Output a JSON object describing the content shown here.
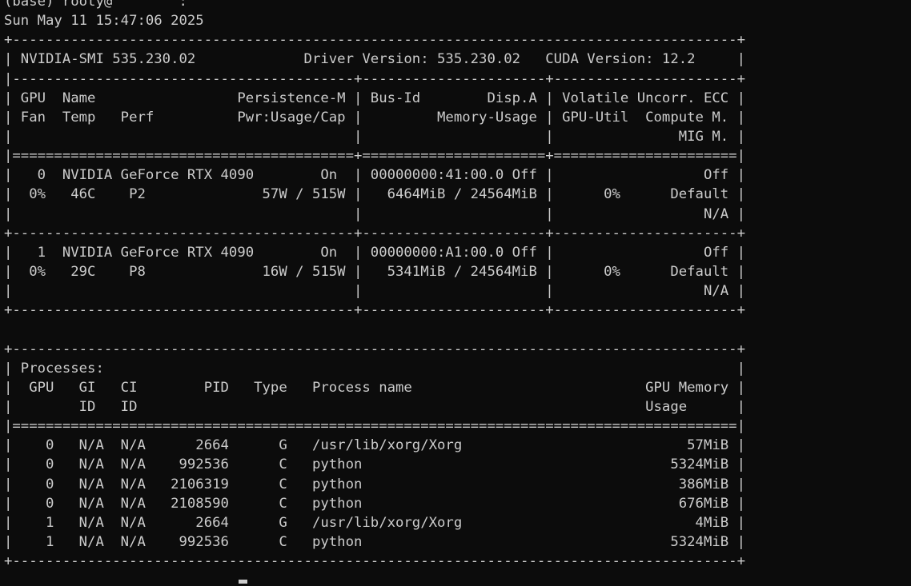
{
  "terminal": {
    "lines": [
      "(base) rooty@        :",
      "Sun May 11 15:47:06 2025",
      "+---------------------------------------------------------------------------------------+",
      "| NVIDIA-SMI 535.230.02             Driver Version: 535.230.02   CUDA Version: 12.2     |",
      "|-----------------------------------------+----------------------+----------------------+",
      "| GPU  Name                 Persistence-M | Bus-Id        Disp.A | Volatile Uncorr. ECC |",
      "| Fan  Temp   Perf          Pwr:Usage/Cap |         Memory-Usage | GPU-Util  Compute M. |",
      "|                                         |                      |               MIG M. |",
      "|=========================================+======================+======================|",
      "|   0  NVIDIA GeForce RTX 4090        On  | 00000000:41:00.0 Off |                  Off |",
      "|  0%   46C    P2              57W / 515W |   6464MiB / 24564MiB |      0%      Default |",
      "|                                         |                      |                  N/A |",
      "+-----------------------------------------+----------------------+----------------------+",
      "|   1  NVIDIA GeForce RTX 4090        On  | 00000000:A1:00.0 Off |                  Off |",
      "|  0%   29C    P8              16W / 515W |   5341MiB / 24564MiB |      0%      Default |",
      "|                                         |                      |                  N/A |",
      "+-----------------------------------------+----------------------+----------------------+",
      "",
      "+---------------------------------------------------------------------------------------+",
      "| Processes:                                                                            |",
      "|  GPU   GI   CI        PID   Type   Process name                            GPU Memory |",
      "|        ID   ID                                                             Usage      |",
      "|=======================================================================================|",
      "|    0   N/A  N/A      2664      G   /usr/lib/xorg/Xorg                           57MiB |",
      "|    0   N/A  N/A    992536      C   python                                     5324MiB |",
      "|    0   N/A  N/A   2106319      C   python                                      386MiB |",
      "|    0   N/A  N/A   2108590      C   python                                      676MiB |",
      "|    1   N/A  N/A      2664      G   /usr/lib/xorg/Xorg                            4MiB |",
      "|    1   N/A  N/A    992536      C   python                                     5324MiB |",
      "+---------------------------------------------------------------------------------------+"
    ]
  }
}
